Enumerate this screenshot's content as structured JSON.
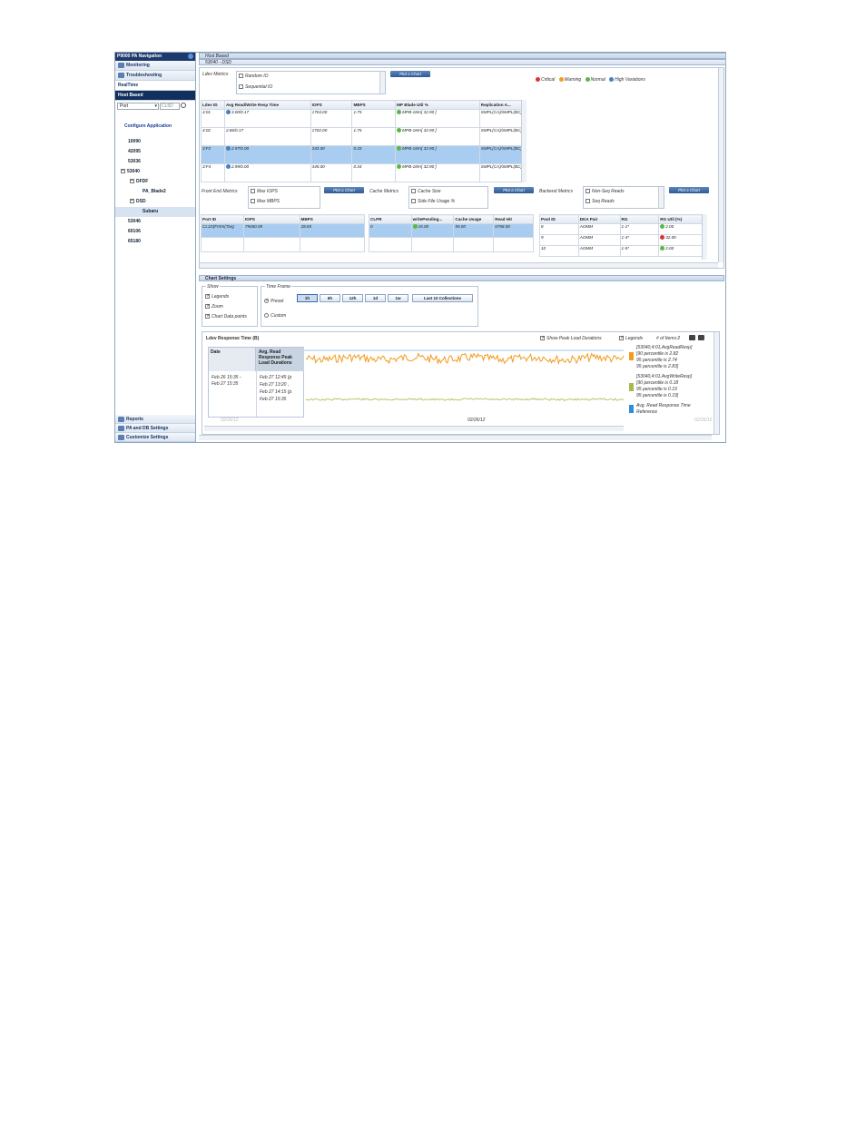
{
  "nav": {
    "title": "P9000 PA Navigation",
    "sections": [
      "Monitoring",
      "Troubleshooting",
      "RealTime",
      "Host Based"
    ],
    "select_value": "Port",
    "search_value": "CL5D",
    "configure": "Configure Application",
    "tree": [
      "10090",
      "42095",
      "53036",
      "53040",
      "DFDF",
      "PA_Blade2",
      "DSD",
      "Subaru",
      "53046",
      "60106",
      "65180"
    ],
    "bottom": [
      "Reports",
      "PA and DB Settings",
      "Customize Settings"
    ]
  },
  "header": {
    "title": "Host Based",
    "subtitle": "53040 - DSD"
  },
  "ldev_metrics": {
    "label": "Ldev Metrics",
    "options": [
      "Random IO",
      "Sequential IO"
    ],
    "plot_button": "Plot a Chart"
  },
  "legend": {
    "critical": "Critical",
    "warning": "Warning",
    "normal": "Normal",
    "high": "High Variations"
  },
  "ldev_table": {
    "headers": [
      "Ldev ID",
      "Avg Read/Write Resp Time",
      "IOPS",
      "MBPS",
      "MP Blade Util %",
      "Replication A..."
    ],
    "rows": [
      [
        "4:01",
        "3.00/0.17",
        "1704.00",
        "1.75",
        "MPB-1MA[ 32.90 ]",
        "SMPL(CA)/SMPL(BC)"
      ],
      [
        "4:02",
        "2.86/0.17",
        "1702.00",
        "1.75",
        "MPB-1MA[ 32.90 ]",
        "SMPL(CA)/SMPL(BC)"
      ],
      [
        "3:F2",
        "2.97/0.00",
        "343.00",
        "0.33",
        "MPB-1MA[ 32.90 ]",
        "SMPL(CA)/SMPL(BC)"
      ],
      [
        "3:F4",
        "2.99/0.00",
        "345.00",
        "0.34",
        "MPB-1MA[ 32.90 ]",
        "SMPL(CA)/SMPL(BC)"
      ]
    ]
  },
  "front_end": {
    "label": "Front End Metrics",
    "options": [
      "Max IOPS",
      "Max MBPS"
    ],
    "button": "Plot a Chart"
  },
  "cache": {
    "label": "Cache Metrics",
    "options": [
      "Cache Size",
      "Side File Usage %"
    ],
    "button": "Plot a Chart"
  },
  "backend": {
    "label": "Backend Metrics",
    "options": [
      "Non-Seq Reads",
      "Seq Reads"
    ],
    "button": "Plot a Chart"
  },
  "port_table": {
    "headers": [
      "Port ID",
      "IOPS",
      "MBPS"
    ],
    "row": [
      "CL1D(FIXm(Targ",
      "79460.00",
      "28.65"
    ]
  },
  "cache_table": {
    "headers": [
      "CLPR",
      "writePending...",
      "Cache Usage",
      "Read Hit"
    ],
    "row": [
      "0",
      "15.00",
      "55.00",
      "6768.00"
    ]
  },
  "pool_table": {
    "headers": [
      "Pool ID",
      "DKA Pair",
      "RG",
      "RG Util (%)"
    ],
    "rows": [
      [
        "8",
        "AOMM",
        "1-1*",
        "2.00"
      ],
      [
        "9",
        "AOMM",
        "1-4*",
        "32.00"
      ],
      [
        "10",
        "AOMM",
        "1-5*",
        "2.00"
      ]
    ]
  },
  "chart_settings": {
    "title": "Chart Settings",
    "show_label": "Show",
    "show_opts": [
      "Legends",
      "Zoom",
      "Chart Data points"
    ],
    "timeframe_label": "Time Frame",
    "preset": "Preset",
    "custom": "Custom",
    "buttons": [
      "1h",
      "6h",
      "12h",
      "1d",
      "1w",
      "Last 10 Collections"
    ]
  },
  "chart": {
    "title": "Ldev Response Time (B)",
    "show_peak": "Show Peak Load Durations",
    "legends": "Legends",
    "items": "# of Items:2",
    "peak_headers": [
      "Date",
      "Avg. Read Response Peak Load Durations"
    ],
    "peak_dates": [
      "Feb 26 15:35 -",
      "Feb 27 15:35"
    ],
    "peak_vals": [
      "Feb 27 12:45 (p",
      "Feb 27 13:20 ,",
      "Feb 27 14:15 (p",
      "Feb 27 15:35"
    ],
    "x_ticks": [
      "02/26/12",
      "02/26/12",
      "02/26/12"
    ],
    "legend_items": [
      {
        "label": "[53040,4:01,AvgReadResp]",
        "lines": [
          "[90 percentile is 2.82",
          "95 percentile is 2.74",
          "95 percentile is 2.83]"
        ],
        "color": "#f29b1e"
      },
      {
        "label": "[53040,4:01,AvgWriteResp]",
        "lines": [
          "[90 percentile is 0.18",
          "95 percentile is 0.19",
          "95 percentile is 0.19]"
        ],
        "color": "#a8b94b"
      },
      {
        "label": "Avg. Read Response Time",
        "lines": [
          "Reference"
        ],
        "color": "#2a8fe0"
      }
    ]
  }
}
